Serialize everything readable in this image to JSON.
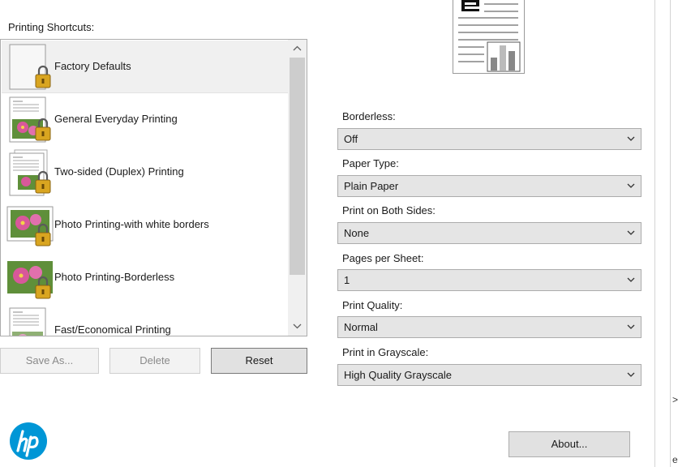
{
  "shortcuts": {
    "label": "Printing Shortcuts:",
    "items": [
      {
        "label": "Factory Defaults",
        "icon": "blank-page-lock-icon",
        "selected": true
      },
      {
        "label": "General Everyday Printing",
        "icon": "document-photo-lock-icon",
        "selected": false
      },
      {
        "label": "Two-sided (Duplex) Printing",
        "icon": "duplex-document-lock-icon",
        "selected": false
      },
      {
        "label": "Photo Printing-with white borders",
        "icon": "photo-bordered-lock-icon",
        "selected": false
      },
      {
        "label": "Photo Printing-Borderless",
        "icon": "photo-borderless-lock-icon",
        "selected": false
      },
      {
        "label": "Fast/Economical Printing",
        "icon": "document-photo-icon",
        "selected": false
      }
    ]
  },
  "buttons": {
    "save_as": "Save As...",
    "delete": "Delete",
    "reset": "Reset",
    "about": "About..."
  },
  "settings": [
    {
      "label": "Borderless:",
      "value": "Off"
    },
    {
      "label": "Paper Type:",
      "value": "Plain Paper"
    },
    {
      "label": "Print on Both Sides:",
      "value": "None"
    },
    {
      "label": "Pages per Sheet:",
      "value": "1"
    },
    {
      "label": "Print Quality:",
      "value": "Normal"
    },
    {
      "label": "Print in Grayscale:",
      "value": "High Quality Grayscale"
    }
  ],
  "edge_text": {
    "top": ">",
    "bottom": "el"
  },
  "colors": {
    "hp_blue": "#0096d6",
    "lock_gold": "#d9a520",
    "photo_pink": "#d8589a",
    "photo_green": "#5f8f3a"
  }
}
